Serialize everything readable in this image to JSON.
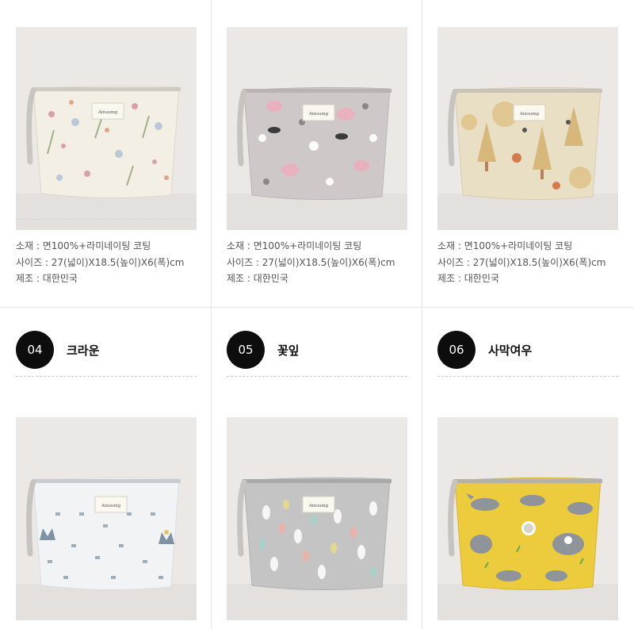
{
  "top_row": [
    {
      "material": "소재 : 면100%+라미네이팅 코팅",
      "size": "사이즈 : 27(넓이)X18.5(높이)X6(폭)cm",
      "origin": "제조 : 대한민국"
    },
    {
      "material": "소재 : 면100%+라미네이팅 코팅",
      "size": "사이즈 : 27(넓이)X18.5(높이)X6(폭)cm",
      "origin": "제조 : 대한민국"
    },
    {
      "material": "소재 : 면100%+라미네이팅 코팅",
      "size": "사이즈 : 27(넓이)X18.5(높이)X6(폭)cm",
      "origin": "제조 : 대한민국"
    }
  ],
  "products": [
    {
      "number": "04",
      "name": "크라운",
      "pattern": "crown"
    },
    {
      "number": "05",
      "name": "꽃잎",
      "pattern": "petal"
    },
    {
      "number": "06",
      "name": "사막여우",
      "pattern": "fox"
    }
  ],
  "brand_label": "Ainsumg",
  "colors": {
    "circle": "#0d0d0d",
    "background": "#ffffff",
    "photo_bg": "#ece8e6"
  }
}
